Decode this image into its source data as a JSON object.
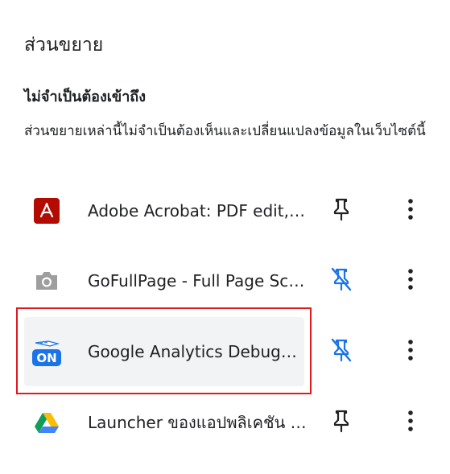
{
  "panel": {
    "title": "ส่วนขยาย",
    "section_heading": "ไม่จำเป็นต้องเข้าถึง",
    "section_description": "ส่วนขยายเหล่านี้ไม่จำเป็นต้องเห็นและเปลี่ยนแปลงข้อมูลในเว็บไซต์นี้"
  },
  "extensions": [
    {
      "name": "Adobe Acrobat: PDF edit, convert, sign tools",
      "icon": "adobe-acrobat-icon",
      "pinned": true
    },
    {
      "name": "GoFullPage - Full Page Screen Capture",
      "icon": "camera-icon",
      "pinned": false
    },
    {
      "name": "Google Analytics Debugger",
      "icon": "ga-debugger-on-icon",
      "pinned": false,
      "icon_badge": "ON"
    },
    {
      "name": "Launcher ของแอปพลิเคชัน Google ไดรฟ์",
      "icon": "google-drive-icon",
      "pinned": true
    }
  ],
  "colors": {
    "pinned": "#202124",
    "unpinned": "#1a73e8",
    "highlight": "#e0191d",
    "hover_bg": "#f1f3f4",
    "adobe_red": "#b30b00"
  }
}
